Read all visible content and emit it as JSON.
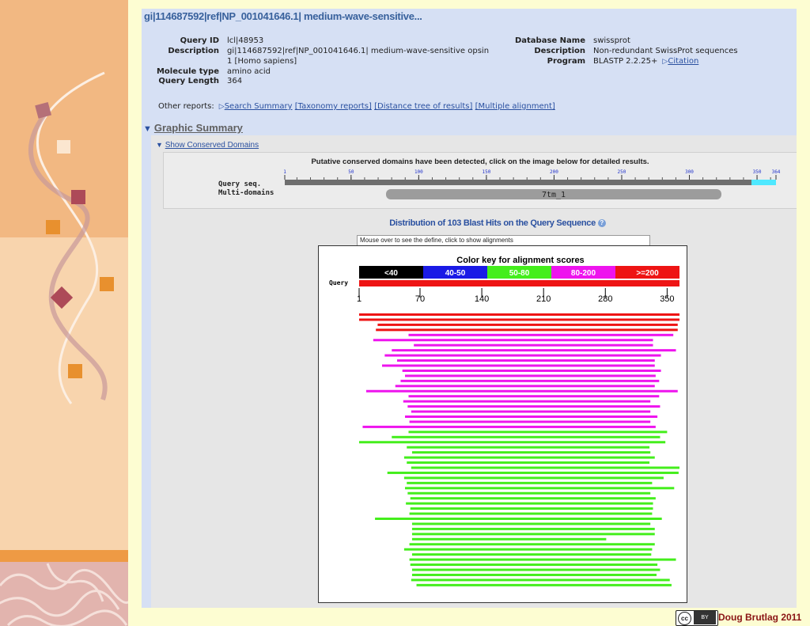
{
  "page_title": "gi|114687592|ref|NP_001041646.1| medium-wave-sensitive...",
  "query_info": {
    "query_id_label": "Query ID",
    "query_id": "lcl|48953",
    "description_label": "Description",
    "description_line1": "gi|114687592|ref|NP_001041646.1| medium-wave-sensitive opsin",
    "description_line2": "1 [Homo sapiens]",
    "molecule_type_label": "Molecule type",
    "molecule_type": "amino acid",
    "query_length_label": "Query Length",
    "query_length": "364"
  },
  "db_info": {
    "database_name_label": "Database Name",
    "database_name": "swissprot",
    "description_label": "Description",
    "description": "Non-redundant SwissProt sequences",
    "program_label": "Program",
    "program": "BLASTP 2.2.25+",
    "citation_link": "Citation"
  },
  "other_reports": {
    "label": "Other reports:",
    "search_summary": "Search Summary",
    "taxonomy_reports": "[Taxonomy reports]",
    "distance_tree": "[Distance tree of results]",
    "multiple_alignment": "[Multiple alignment]"
  },
  "graphic_summary": {
    "title": "Graphic Summary",
    "show_conserved_domains": "Show Conserved Domains",
    "cd_note": "Putative conserved domains have been detected, click on the image below for detailed results.",
    "query_seq_label": "Query seq.",
    "multi_domains_label": "Multi-domains",
    "domain_name": "7tm_1",
    "ruler_ticks": [
      "1",
      "50",
      "100",
      "150",
      "200",
      "250",
      "300",
      "350",
      "364"
    ]
  },
  "distribution": {
    "title": "Distribution of 103 Blast Hits on the Query Sequence",
    "mouse_hint": "Mouse over to see the define, click to show alignments",
    "color_key_title": "Color key for alignment scores",
    "query_label": "Query",
    "axis_ticks": [
      "1",
      "70",
      "140",
      "210",
      "280",
      "350"
    ]
  },
  "chart_data": {
    "type": "bar",
    "title": "Distribution of 103 Blast Hits on the Query Sequence",
    "score_bins": [
      {
        "label": "<40",
        "color": "#000000"
      },
      {
        "label": "40-50",
        "color": "#1a1ae6"
      },
      {
        "label": "50-80",
        "color": "#44ee1c"
      },
      {
        "label": "80-200",
        "color": "#ee14ee"
      },
      {
        "label": ">=200",
        "color": "#ee1414"
      }
    ],
    "query_range": [
      1,
      364
    ],
    "hits": [
      {
        "start": 1,
        "end": 364,
        "bin": ">=200"
      },
      {
        "start": 1,
        "end": 364,
        "bin": ">=200"
      },
      {
        "start": 22,
        "end": 362,
        "bin": ">=200"
      },
      {
        "start": 20,
        "end": 362,
        "bin": ">=200"
      },
      {
        "start": 57,
        "end": 357,
        "bin": "80-200"
      },
      {
        "start": 17,
        "end": 334,
        "bin": "80-200"
      },
      {
        "start": 63,
        "end": 334,
        "bin": "80-200"
      },
      {
        "start": 38,
        "end": 360,
        "bin": "80-200"
      },
      {
        "start": 30,
        "end": 343,
        "bin": "80-200"
      },
      {
        "start": 44,
        "end": 336,
        "bin": "80-200"
      },
      {
        "start": 27,
        "end": 336,
        "bin": "80-200"
      },
      {
        "start": 50,
        "end": 343,
        "bin": "80-200"
      },
      {
        "start": 53,
        "end": 337,
        "bin": "80-200"
      },
      {
        "start": 48,
        "end": 341,
        "bin": "80-200"
      },
      {
        "start": 42,
        "end": 336,
        "bin": "80-200"
      },
      {
        "start": 9,
        "end": 362,
        "bin": "80-200"
      },
      {
        "start": 57,
        "end": 341,
        "bin": "80-200"
      },
      {
        "start": 51,
        "end": 331,
        "bin": "80-200"
      },
      {
        "start": 56,
        "end": 342,
        "bin": "80-200"
      },
      {
        "start": 60,
        "end": 331,
        "bin": "80-200"
      },
      {
        "start": 53,
        "end": 339,
        "bin": "80-200"
      },
      {
        "start": 58,
        "end": 331,
        "bin": "80-200"
      },
      {
        "start": 5,
        "end": 337,
        "bin": "80-200"
      },
      {
        "start": 57,
        "end": 350,
        "bin": "50-80"
      },
      {
        "start": 38,
        "end": 342,
        "bin": "50-80"
      },
      {
        "start": 1,
        "end": 348,
        "bin": "50-80"
      },
      {
        "start": 55,
        "end": 330,
        "bin": "50-80"
      },
      {
        "start": 61,
        "end": 331,
        "bin": "50-80"
      },
      {
        "start": 52,
        "end": 336,
        "bin": "50-80"
      },
      {
        "start": 55,
        "end": 330,
        "bin": "50-80"
      },
      {
        "start": 60,
        "end": 364,
        "bin": "50-80"
      },
      {
        "start": 33,
        "end": 363,
        "bin": "50-80"
      },
      {
        "start": 52,
        "end": 346,
        "bin": "50-80"
      },
      {
        "start": 55,
        "end": 333,
        "bin": "50-80"
      },
      {
        "start": 53,
        "end": 358,
        "bin": "50-80"
      },
      {
        "start": 56,
        "end": 331,
        "bin": "50-80"
      },
      {
        "start": 59,
        "end": 337,
        "bin": "50-80"
      },
      {
        "start": 54,
        "end": 334,
        "bin": "50-80"
      },
      {
        "start": 59,
        "end": 334,
        "bin": "50-80"
      },
      {
        "start": 58,
        "end": 333,
        "bin": "50-80"
      },
      {
        "start": 19,
        "end": 344,
        "bin": "50-80"
      },
      {
        "start": 61,
        "end": 331,
        "bin": "50-80"
      },
      {
        "start": 61,
        "end": 336,
        "bin": "50-80"
      },
      {
        "start": 61,
        "end": 336,
        "bin": "50-80"
      },
      {
        "start": 61,
        "end": 281,
        "bin": "50-80"
      },
      {
        "start": 58,
        "end": 336,
        "bin": "50-80"
      },
      {
        "start": 52,
        "end": 333,
        "bin": "50-80"
      },
      {
        "start": 61,
        "end": 332,
        "bin": "50-80"
      },
      {
        "start": 58,
        "end": 360,
        "bin": "50-80"
      },
      {
        "start": 59,
        "end": 339,
        "bin": "50-80"
      },
      {
        "start": 61,
        "end": 342,
        "bin": "50-80"
      },
      {
        "start": 61,
        "end": 338,
        "bin": "50-80"
      },
      {
        "start": 60,
        "end": 353,
        "bin": "50-80"
      },
      {
        "start": 66,
        "end": 355,
        "bin": "50-80"
      }
    ]
  },
  "footer": {
    "cc_text": "cc",
    "by_text": "BY",
    "credit": "Doug Brutlag 2011"
  }
}
